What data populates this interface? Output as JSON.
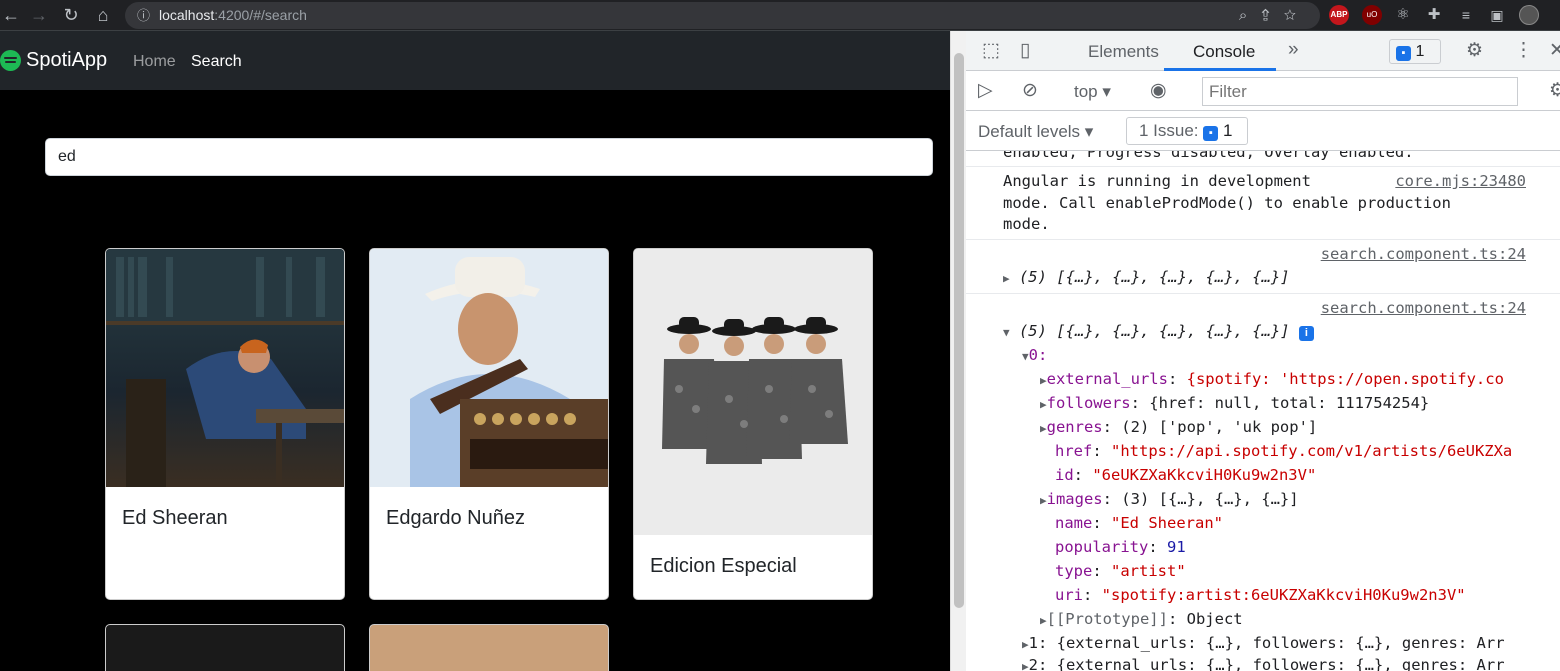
{
  "browser": {
    "url_host": "localhost",
    "url_rest": ":4200/#/search"
  },
  "app": {
    "brand": "SpotiApp",
    "nav": [
      {
        "label": "Home",
        "active": false
      },
      {
        "label": "Search",
        "active": true
      }
    ],
    "search_value": "ed",
    "cards": [
      {
        "name": "Ed Sheeran"
      },
      {
        "name": "Edgardo Nuñez"
      },
      {
        "name": "Edicion Especial"
      }
    ]
  },
  "devtools": {
    "tabs": [
      "Elements",
      "Console"
    ],
    "active_tab": "Console",
    "message_badge": "1",
    "context": "top",
    "filter_placeholder": "Filter",
    "levels": "Default levels",
    "issues_label": "1 Issue:",
    "issues_count": "1",
    "log": {
      "truncated": "enabled, Progress disabled, Overlay enabled.",
      "angular_1": "Angular is running in development",
      "angular_2": "mode. Call enableProdMode() to enable production",
      "angular_3": "mode.",
      "angular_src": "core.mjs:23480",
      "src1": "search.component.ts:24",
      "arr_collapsed": "(5) [{…}, {…}, {…}, {…}, {…}]",
      "src2": "search.component.ts:24",
      "arr_expanded": "(5) [{…}, {…}, {…}, {…}, {…}]",
      "idx0": "0:",
      "props": [
        {
          "key": "external_urls",
          "val": "{spotify: 'https://open.spotify.co",
          "exp": true
        },
        {
          "key": "followers",
          "val": "{href: null, total: 111754254}",
          "exp": true
        },
        {
          "key": "genres",
          "val": "(2) ['pop', 'uk pop']",
          "exp": true
        },
        {
          "key": "href",
          "val": "\"https://api.spotify.com/v1/artists/6eUKZXa",
          "exp": false
        },
        {
          "key": "id",
          "val": "\"6eUKZXaKkcviH0Ku9w2n3V\"",
          "exp": false
        },
        {
          "key": "images",
          "val": "(3) [{…}, {…}, {…}]",
          "exp": true
        },
        {
          "key": "name",
          "val": "\"Ed Sheeran\"",
          "exp": false
        },
        {
          "key": "popularity",
          "val": "91",
          "exp": false
        },
        {
          "key": "type",
          "val": "\"artist\"",
          "exp": false
        },
        {
          "key": "uri",
          "val": "\"spotify:artist:6eUKZXaKkcviH0Ku9w2n3V\"",
          "exp": false
        },
        {
          "key": "[[Prototype]]",
          "val": "Object",
          "exp": true
        }
      ],
      "item1": "1: {external_urls: {…}, followers: {…}, genres: Arr",
      "item2": "2: {external_urls: {…}, followers: {…}, genres: Arr"
    }
  }
}
